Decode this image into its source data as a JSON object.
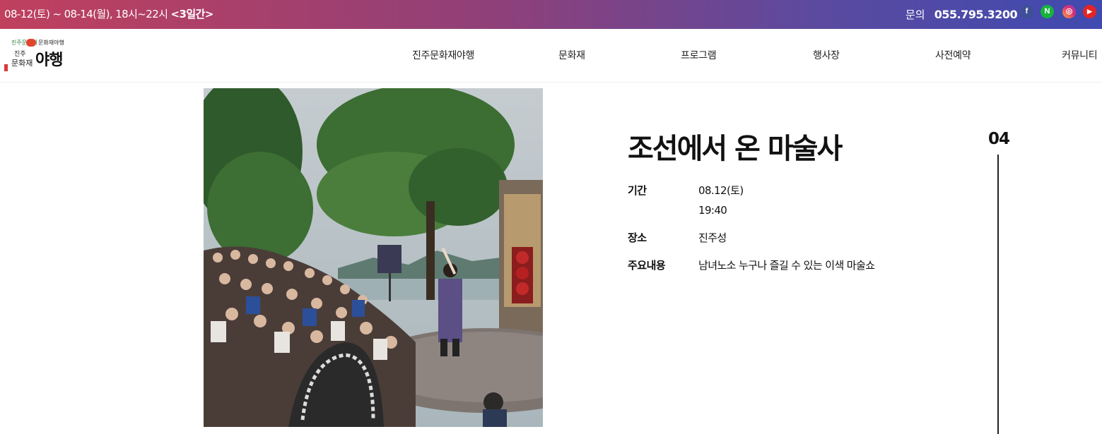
{
  "topbar": {
    "dates": "08-12(토) ~ 08-14(월), 18시~22시 ",
    "duration": "<3일간>",
    "contact_label": "문의",
    "contact_number": "055.795.3200",
    "social": {
      "facebook": "f",
      "naver": "N",
      "instagram": "◎",
      "youtube": "▶"
    },
    "gradient_colors": [
      "#c0405e",
      "#8f4079",
      "#5a4aa0",
      "#3f4ab0"
    ]
  },
  "logo": {
    "small_text": "진주문화재",
    "small_text_2": "문화재야행",
    "line1": "진주",
    "line2": "문화재",
    "big_text": "야행"
  },
  "nav": {
    "items": [
      "진주문화재야행",
      "문화재",
      "프로그램",
      "행사장",
      "사전예약",
      "커뮤니티"
    ]
  },
  "program": {
    "index": "04",
    "title": "조선에서 온 마술사",
    "period_label": "기간",
    "period_date": "08.12(토)",
    "period_time": "19:40",
    "place_label": "장소",
    "place_value": "진주성",
    "content_label": "주요내용",
    "content_value": "남녀노소 누구나 즐길 수 있는 이색 마술쇼"
  }
}
